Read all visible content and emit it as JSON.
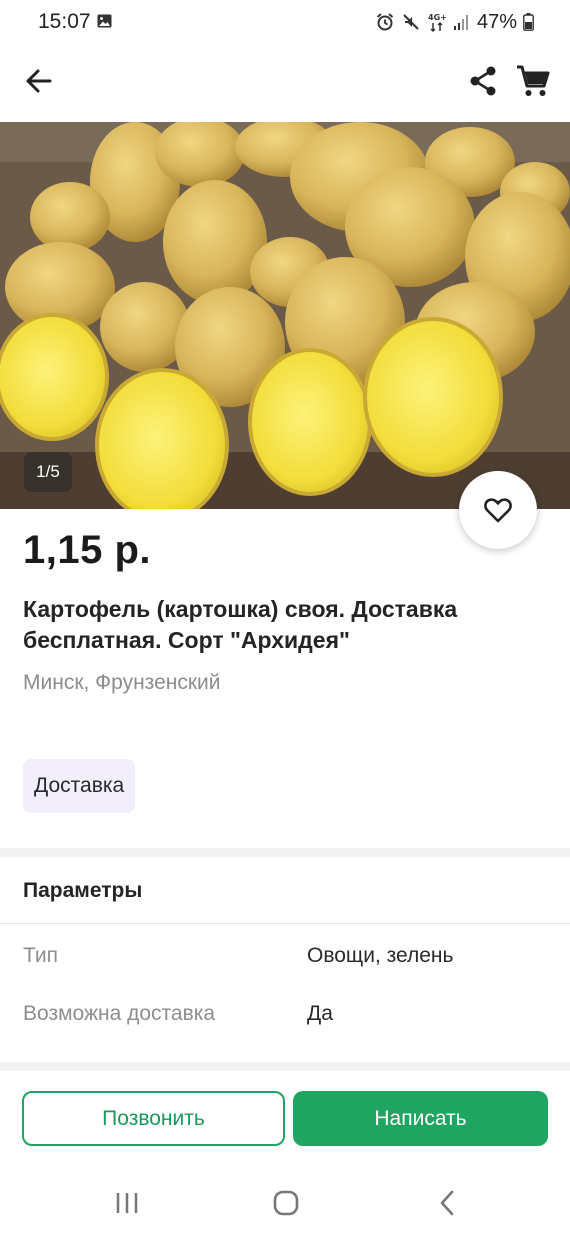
{
  "status_bar": {
    "time": "15:07",
    "network": "4G+",
    "battery": "47%"
  },
  "toolbar": {
    "back_icon": "arrow-left-icon",
    "share_icon": "share-icon",
    "cart_icon": "cart-icon"
  },
  "product": {
    "image_counter": "1/5",
    "price": "1,15 р.",
    "title": "Картофель (картошка) своя. Доставка бесплатная. Сорт \"Архидея\"",
    "location": "Минск, Фрунзенский",
    "tag": "Доставка"
  },
  "params": {
    "heading": "Параметры",
    "rows": [
      {
        "label": "Тип",
        "value": "Овощи, зелень"
      },
      {
        "label": "Возможна доставка",
        "value": "Да"
      }
    ]
  },
  "actions": {
    "call_label": "Позвонить",
    "write_label": "Написать"
  },
  "colors": {
    "accent": "#1fa561",
    "chip_bg": "#f3eefc"
  }
}
